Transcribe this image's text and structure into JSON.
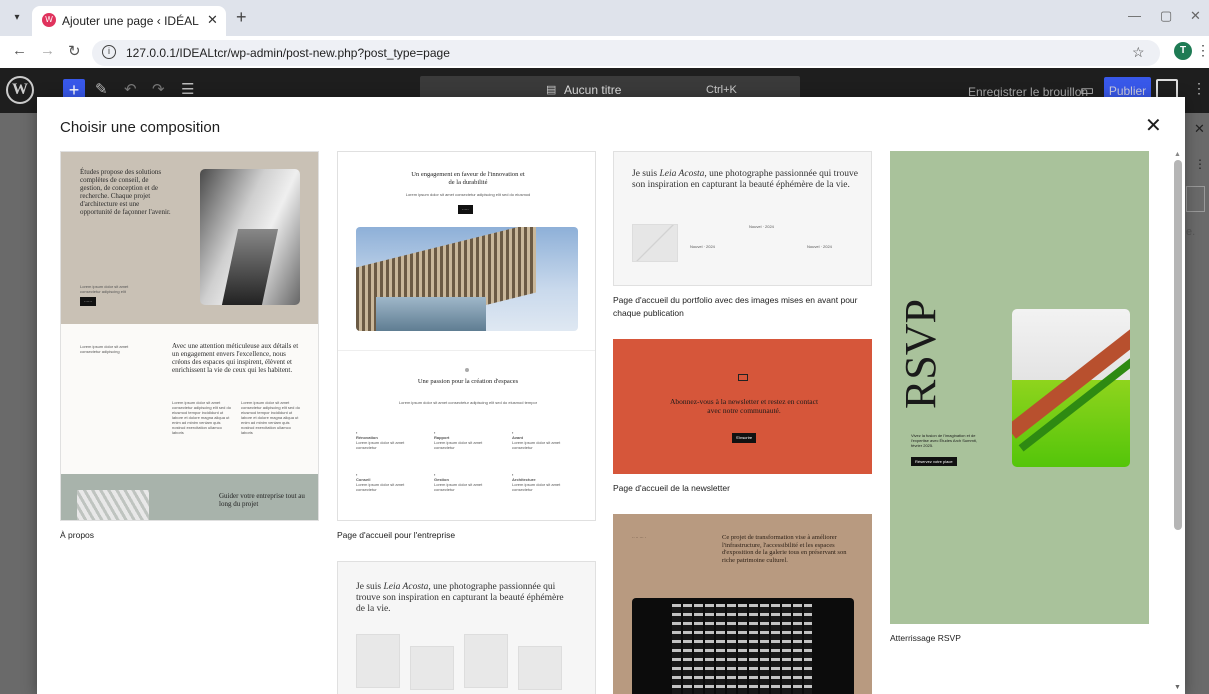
{
  "browser": {
    "tab_title": "Ajouter une page ‹ IDÉAL — W",
    "url": "127.0.0.1/IDEALtcr/wp-admin/post-new.php?post_type=page",
    "profile_initial": "T"
  },
  "editor": {
    "document_title": "Aucun titre",
    "shortcut": "Ctrl+K",
    "save_draft": "Enregistrer le brouillon",
    "publish": "Publier"
  },
  "modal": {
    "title": "Choisir une composition"
  },
  "patterns": {
    "a_propos": {
      "caption": "À propos",
      "hero_text": "Études propose des solutions complètes de conseil, de gestion, de conception et de recherche. Chaque projet d'architecture est une opportunité de façonner l'avenir.",
      "mid_heading": "Avec une attention méticuleuse aux détails et un engagement envers l'excellence, nous créons des espaces qui inspirent, élèvent et enrichissent la vie de ceux qui les habitent.",
      "bottom_heading": "Guider votre entreprise tout au long du projet"
    },
    "entreprise": {
      "caption": "Page d'accueil pour l'entreprise",
      "heading": "Un engagement en faveur de l'innovation et de la durabilité",
      "section_heading": "Une passion pour la création d'espaces"
    },
    "portfolio_a": {
      "heading_pre": "Je suis ",
      "heading_name": "Leia Acosta",
      "heading_post": ", une photographe passionnée qui trouve son inspiration en capturant la beauté éphémère de la vie."
    },
    "portfolio": {
      "caption": "Page d'accueil du portfolio avec des images mises en avant pour chaque publication",
      "heading_pre": "Je suis ",
      "heading_name": "Leia Acosta",
      "heading_post": ", une photographe passionnée qui trouve son inspiration en capturant la beauté éphémère de la vie."
    },
    "newsletter": {
      "caption": "Page d'accueil de la newsletter",
      "heading": "Abonnez-vous à la newsletter et restez en contact avec notre communauté.",
      "button": "S'inscrire",
      "bg_color": "#d6563a"
    },
    "transformation": {
      "heading": "Ce projet de transformation vise à améliorer l'infrastructure, l'accessibilité et les espaces d'exposition de la galerie tous en préservant son riche patrimoine culturel.",
      "bg_color": "#b89a80"
    },
    "rsvp": {
      "caption": "Atterrissage RSVP",
      "title": "RSVP",
      "bg_color": "#a9c29b"
    }
  }
}
